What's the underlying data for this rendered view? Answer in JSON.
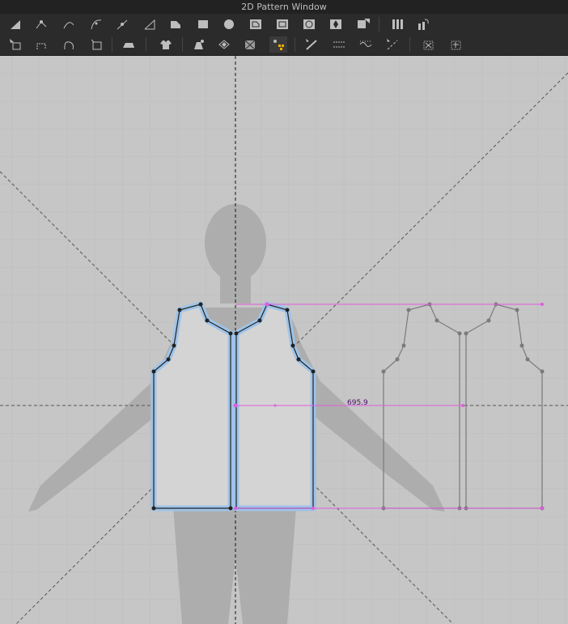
{
  "window": {
    "title": "2D Pattern Window"
  },
  "toolbar_row1": [
    "edit-pattern-tool",
    "edit-point-tool",
    "edit-curve-point-tool",
    "edit-curvature-tool",
    "add-point-tool",
    "segment-tool",
    "polygon-tool",
    "rectangle-tool",
    "circle-tool",
    "internal-polygon-tool",
    "internal-rectangle-tool",
    "internal-circle-tool",
    "internal-diamond-tool",
    "dart-tool",
    "pleat-tool",
    "fold-tool"
  ],
  "toolbar_row2": [
    "edit-sewing-tool",
    "segment-sewing-tool",
    "free-sewing-tool",
    "check-sewing-tool",
    "iron-tool",
    "garment-tool",
    "trace-tool",
    "fabric-tool",
    "texture-tool",
    "graphic-tool",
    "tape-tool",
    "puckering-tool",
    "pin-tool",
    "grade-tool",
    "pattern-grid-tool"
  ],
  "canvas": {
    "measurement_label": "695.9",
    "colors": {
      "selected_outline": "#9ec3e8",
      "measurement_line": "#e05ce0",
      "avatar": "#adadad",
      "grid": "#bcbcbc"
    }
  }
}
